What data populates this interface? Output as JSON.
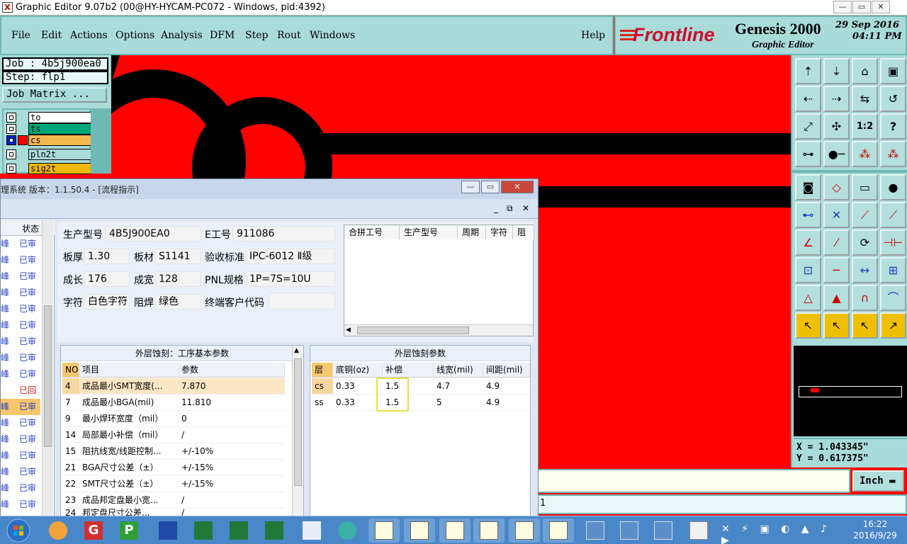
{
  "window": {
    "title": "Graphic Editor 9.07b2 (00@HY-HYCAM-PC072 - Windows, pid:4392)",
    "minimize": "—",
    "restore": "▭",
    "close": "✕"
  },
  "menu": [
    "File",
    "Edit",
    "Actions",
    "Options",
    "Analysis",
    "DFM",
    "Step",
    "Rout",
    "Windows"
  ],
  "help": "Help",
  "brand": {
    "logo": "Frontline",
    "product": "Genesis 2000",
    "subtitle": "Graphic Editor",
    "date": "29 Sep 2016",
    "time": "04:11 PM"
  },
  "job": {
    "job_label": "Job : 4b5j900ea0",
    "step_label": "Step: flp1",
    "matrix_button": "Job Matrix ..."
  },
  "layers": [
    {
      "name": "to",
      "color": "#ffffff"
    },
    {
      "name": "ts",
      "color": "#00a878"
    },
    {
      "name": "cs",
      "color": "#f4b84e"
    },
    {
      "name": "pln2t",
      "color": "#a9dbd9"
    },
    {
      "name": "sig2t",
      "color": "#f0b800"
    }
  ],
  "coords": {
    "x": "X = 1.043345\"",
    "y": "Y = 0.617375\""
  },
  "units": "Inch",
  "status_line": "1",
  "dialog": {
    "title": "理系统  版本：1.1.50.4 - [流程指示]",
    "status_col": "状态",
    "rows": [
      {
        "a": "峰",
        "b": "已审"
      },
      {
        "a": "峰",
        "b": "已审"
      },
      {
        "a": "峰",
        "b": "已审"
      },
      {
        "a": "峰",
        "b": "已审"
      },
      {
        "a": "峰",
        "b": "已审"
      },
      {
        "a": "峰",
        "b": "已审"
      },
      {
        "a": "峰",
        "b": "已审"
      },
      {
        "a": "峰",
        "b": "已审"
      },
      {
        "a": "峰",
        "b": "已审"
      },
      {
        "a": "",
        "b": "已回"
      },
      {
        "a": "峰",
        "b": "已审"
      },
      {
        "a": "峰",
        "b": "已审"
      },
      {
        "a": "峰",
        "b": "已审"
      },
      {
        "a": "峰",
        "b": "已审"
      },
      {
        "a": "峰",
        "b": "已审"
      },
      {
        "a": "峰",
        "b": "已审"
      },
      {
        "a": "峰",
        "b": "已审"
      }
    ],
    "info": {
      "model_label": "生产型号",
      "model": "4B5J900EA0",
      "e_label": "E工号",
      "e": "911086",
      "thick_label": "板厚",
      "thick": "1.30",
      "mat_label": "板材",
      "mat": "S1141",
      "std_label": "验收标准",
      "std": "IPC-6012 Ⅱ级",
      "len_label": "成长",
      "len": "176",
      "wid_label": "成宽",
      "wid": "128",
      "pnl_label": "PNL规格",
      "pnl": "1P=7S=10U",
      "char_label": "字符",
      "char": "白色字符",
      "mask_label": "阻焊",
      "mask": "绿色",
      "cust_label": "终端客户代码",
      "cust": ""
    },
    "combine_headers": [
      "合拼工号",
      "生产型号",
      "周期",
      "字符",
      "阻焊"
    ],
    "left_panel": {
      "title": "外层蚀刻：工序基本参数",
      "headers": [
        "NO",
        "项目",
        "参数"
      ],
      "rows": [
        {
          "no": "4",
          "item": "成品最小SMT宽度(...",
          "param": "7.870"
        },
        {
          "no": "7",
          "item": "成品最小BGA(mil)",
          "param": "11.810"
        },
        {
          "no": "9",
          "item": "最小焊环宽度（mil）",
          "param": "0"
        },
        {
          "no": "14",
          "item": "局部最小补偿（mil）",
          "param": "/"
        },
        {
          "no": "15",
          "item": "阻抗线宽/线距控制...",
          "param": "+/-10%"
        },
        {
          "no": "21",
          "item": "BGA尺寸公差（±）",
          "param": "+/-15%"
        },
        {
          "no": "22",
          "item": "SMT尺寸公差（±）",
          "param": "+/-15%"
        },
        {
          "no": "23",
          "item": "成品邦定盘最小宽...",
          "param": "/"
        },
        {
          "no": "24",
          "item": "邦定盘尺寸公差...",
          "param": "/"
        }
      ]
    },
    "right_panel": {
      "title": "外层蚀刻参数",
      "headers": [
        "层",
        "底铜(oz)",
        "补偿",
        "线宽(mil)",
        "间距(mil)"
      ],
      "rows": [
        {
          "layer": "cs",
          "cu": "0.33",
          "comp": "1.5",
          "lw": "4.7",
          "sp": "4.9"
        },
        {
          "layer": "ss",
          "cu": "0.33",
          "comp": "1.5",
          "lw": "5",
          "sp": "4.9"
        }
      ]
    }
  },
  "taskbar": {
    "time": "16:22",
    "date": "2016/9/29"
  }
}
